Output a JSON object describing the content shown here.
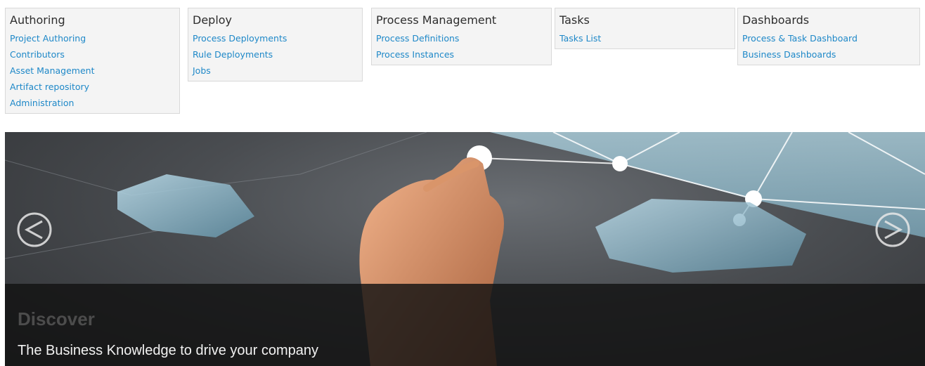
{
  "menus": [
    {
      "title": "Authoring",
      "items": [
        "Project Authoring",
        "Contributors",
        "Asset Management",
        "Artifact repository",
        "Administration"
      ]
    },
    {
      "title": "Deploy",
      "items": [
        "Process Deployments",
        "Rule Deployments",
        "Jobs"
      ]
    },
    {
      "title": "Process Management",
      "items": [
        "Process Definitions",
        "Process Instances"
      ]
    },
    {
      "title": "Tasks",
      "items": [
        "Tasks List"
      ]
    },
    {
      "title": "Dashboards",
      "items": [
        "Process & Task Dashboard",
        "Business Dashboards"
      ]
    }
  ],
  "carousel": {
    "title": "Discover",
    "text": "The Business Knowledge to drive your company",
    "prev_icon": "chevron-left-circle-icon",
    "next_icon": "chevron-right-circle-icon"
  },
  "colors": {
    "link": "#1e88c8",
    "card_bg": "#f4f4f4",
    "caption_bg": "#121212"
  }
}
